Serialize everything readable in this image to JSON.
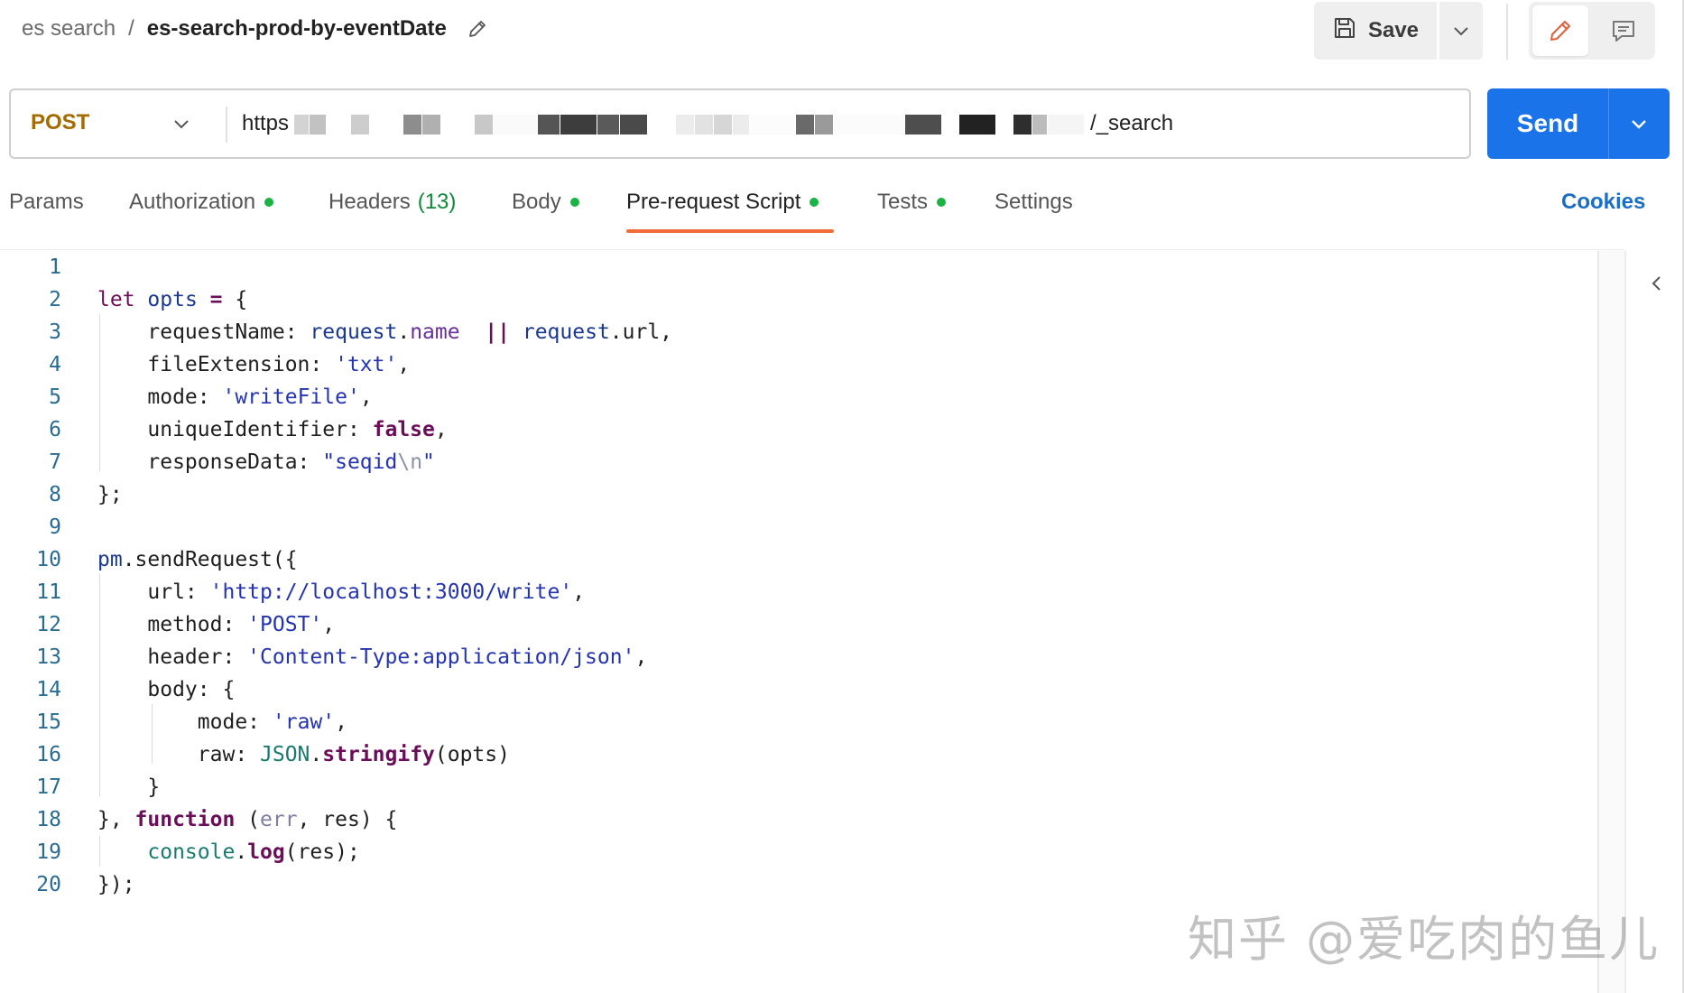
{
  "header": {
    "breadcrumb_parent": "es search",
    "breadcrumb_separator": "/",
    "request_name": "es-search-prod-by-eventDate",
    "save_label": "Save",
    "icons": [
      "pencil-icon",
      "floppy-disk-icon",
      "chevron-down-icon",
      "comment-icon"
    ]
  },
  "request": {
    "method": "POST",
    "url_visible_prefix": "https",
    "url_visible_suffix": "/_search",
    "send_label": "Send"
  },
  "tabs": [
    {
      "label": "Params",
      "count": "",
      "has_dot": false,
      "active": false
    },
    {
      "label": "Authorization",
      "count": "",
      "has_dot": true,
      "active": false
    },
    {
      "label": "Headers",
      "count": "(13)",
      "has_dot": false,
      "active": false
    },
    {
      "label": "Body",
      "count": "",
      "has_dot": true,
      "active": false
    },
    {
      "label": "Pre-request Script",
      "count": "",
      "has_dot": true,
      "active": true
    },
    {
      "label": "Tests",
      "count": "",
      "has_dot": true,
      "active": false
    },
    {
      "label": "Settings",
      "count": "",
      "has_dot": false,
      "active": false
    }
  ],
  "cookies_label": "Cookies",
  "colors": {
    "accent_blue": "#1a73e8",
    "method_post": "#a36b00",
    "tab_underline": "#f26b3a",
    "status_dot": "#1cb344",
    "cookies_link": "#1a6fc4"
  },
  "code_lines": [
    "",
    "let opts = {",
    "    requestName: request.name  || request.url,",
    "    fileExtension: 'txt',",
    "    mode: 'writeFile',",
    "    uniqueIdentifier: false,",
    "    responseData: \"seqid\\n\"",
    "};",
    "",
    "pm.sendRequest({",
    "    url: 'http://localhost:3000/write',",
    "    method: 'POST',",
    "    header: 'Content-Type:application/json',",
    "    body: {",
    "        mode: 'raw',",
    "        raw: JSON.stringify(opts)",
    "    }",
    "}, function (err, res) {",
    "    console.log(res);",
    "});"
  ],
  "watermark": "知乎 @爱吃肉的鱼儿"
}
